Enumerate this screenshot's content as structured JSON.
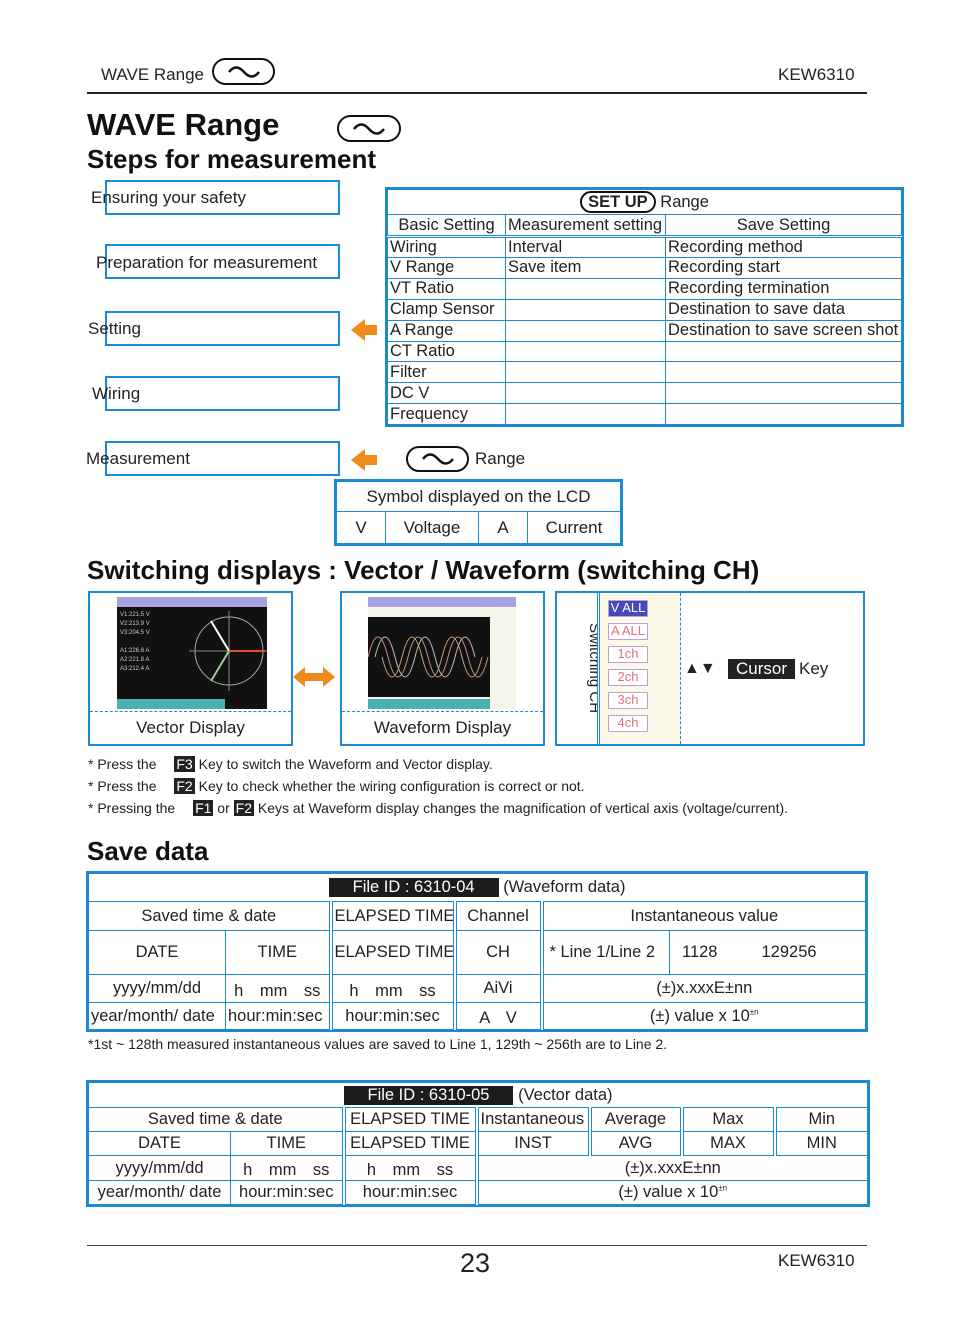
{
  "header": {
    "section": "WAVE Range",
    "model": "KEW6310"
  },
  "title": {
    "main": "WAVE Range",
    "sub": "Steps for measurement"
  },
  "flow": [
    "Ensuring your safety",
    "Preparation for measurement",
    "Setting",
    "Wiring",
    "Measurement"
  ],
  "setup_table": {
    "key": "SET UP",
    "title": "Range",
    "columns": [
      "Basic Setting",
      "Measurement setting",
      "Save Setting"
    ],
    "rows": [
      [
        "Wiring",
        "Interval",
        "Recording method"
      ],
      [
        "V Range",
        "Save item",
        "Recording start"
      ],
      [
        "VT Ratio",
        "",
        "Recording termination"
      ],
      [
        "Clamp Sensor",
        "",
        "Destination to save data"
      ],
      [
        "A Range",
        "",
        "Destination to save screen shot"
      ],
      [
        "CT Ratio",
        "",
        ""
      ],
      [
        "Filter",
        "",
        ""
      ],
      [
        "DC V",
        "",
        ""
      ],
      [
        "Frequency",
        "",
        ""
      ]
    ]
  },
  "range_label": "Range",
  "symbol_table": {
    "title": "Symbol displayed on the LCD",
    "cells": [
      "V",
      "Voltage",
      "A",
      "Current"
    ]
  },
  "switching": {
    "heading": "Switching displays : Vector / Waveform (switching CH)",
    "vector_label": "Vector Display",
    "waveform_label": "Waveform Display",
    "switch_label": "Switching CH",
    "channels": [
      "V ALL",
      "A ALL",
      "1ch",
      "2ch",
      "3ch",
      "4ch"
    ],
    "cursor": "Cursor",
    "key": "Key"
  },
  "notes": [
    {
      "pre": "* Press the",
      "keys": [
        "F3"
      ],
      "post": "Key to switch the Waveform and Vector display."
    },
    {
      "pre": "* Press the",
      "keys": [
        "F2"
      ],
      "post": "Key to check whether the wiring configuration is correct or not."
    },
    {
      "pre": "* Pressing the",
      "keys": [
        "F1",
        "F2"
      ],
      "mid": "or",
      "post": "Keys at Waveform display changes the magnification of vertical axis (voltage/current)."
    }
  ],
  "save": {
    "heading": "Save data",
    "t1": {
      "file_id": "File ID : 6310-04",
      "kind": "(Waveform data)",
      "h": [
        "Saved time & date",
        "ELAPSED TIME",
        "Channel",
        "Instantaneous value"
      ],
      "r2": [
        "DATE",
        "TIME",
        "ELAPSED TIME",
        "CH",
        "* Line 1/Line 2",
        "1128",
        "129256"
      ],
      "r3": [
        "yyyy/mm/dd",
        "h　mm　ss",
        "h　mm　ss",
        "AiVi",
        "(±)x.xxxE±nn"
      ],
      "r4": [
        "year/month/ date",
        "hour:min:sec",
        "hour:min:sec",
        "A　V",
        "(±) value x 10"
      ],
      "footnote": "*1st ~ 128th measured instantaneous values are saved to Line 1, 129th ~ 256th are to Line 2."
    },
    "t2": {
      "file_id": "File ID : 6310-05",
      "kind": "(Vector data)",
      "h": [
        "Saved time & date",
        "ELAPSED TIME",
        "Instantaneous",
        "Average",
        "Max",
        "Min"
      ],
      "r2": [
        "DATE",
        "TIME",
        "ELAPSED TIME",
        "INST",
        "AVG",
        "MAX",
        "MIN"
      ],
      "r3": [
        "yyyy/mm/dd",
        "h　mm　ss",
        "h　mm　ss",
        "(±)x.xxxE±nn"
      ],
      "r4": [
        "year/month/ date",
        "hour:min:sec",
        "hour:min:sec",
        "(±) value x 10"
      ]
    },
    "exp": "±n"
  },
  "footer": {
    "page": "23",
    "model": "KEW6310"
  },
  "colors": {
    "accent": "#1a8ad4",
    "arrow": "#f08a1c"
  }
}
